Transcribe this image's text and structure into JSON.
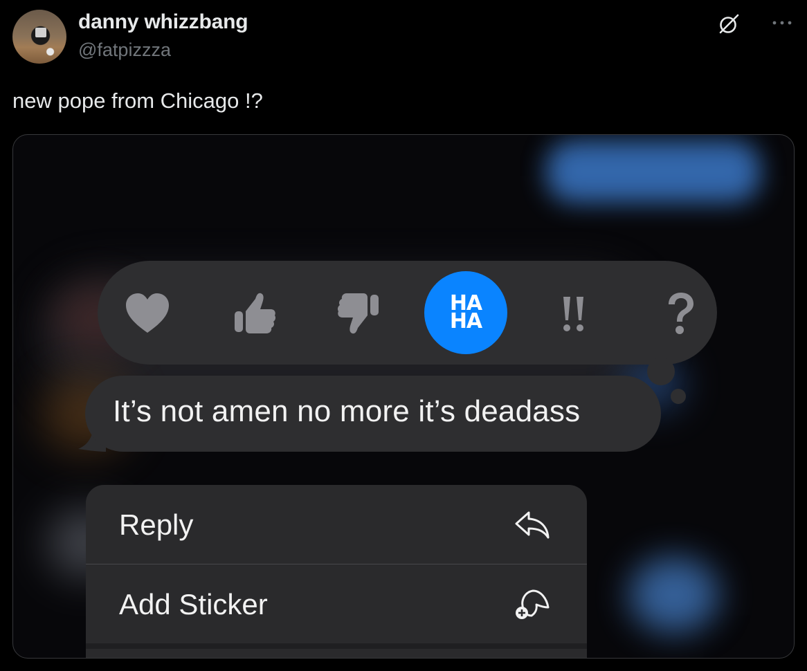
{
  "tweet": {
    "display_name": "danny whizzbang",
    "handle": "@fatpizzza",
    "text": "new pope from Chicago !?",
    "icons": [
      "avatar",
      "grok-icon",
      "more-icon"
    ]
  },
  "media": {
    "reactions": [
      {
        "name": "heart",
        "icon": "heart-icon"
      },
      {
        "name": "thumbs-up",
        "icon": "thumbs-up-icon"
      },
      {
        "name": "thumbs-down",
        "icon": "thumbs-down-icon"
      },
      {
        "name": "haha",
        "icon": "haha-icon",
        "line1": "HA",
        "line2": "HA",
        "selected": true
      },
      {
        "name": "exclamation",
        "icon": "double-exclamation-icon"
      },
      {
        "name": "question",
        "icon": "question-icon"
      }
    ],
    "message": "It’s not amen no more it’s deadass",
    "menu": [
      {
        "label": "Reply",
        "icon": "reply-arrow-icon"
      },
      {
        "label": "Add Sticker",
        "icon": "add-sticker-icon"
      }
    ],
    "colors": {
      "accent": "#0a84ff",
      "bubble": "#2e2e30",
      "menu": "#2a2a2c",
      "reaction_icon": "#8e8e93"
    }
  }
}
